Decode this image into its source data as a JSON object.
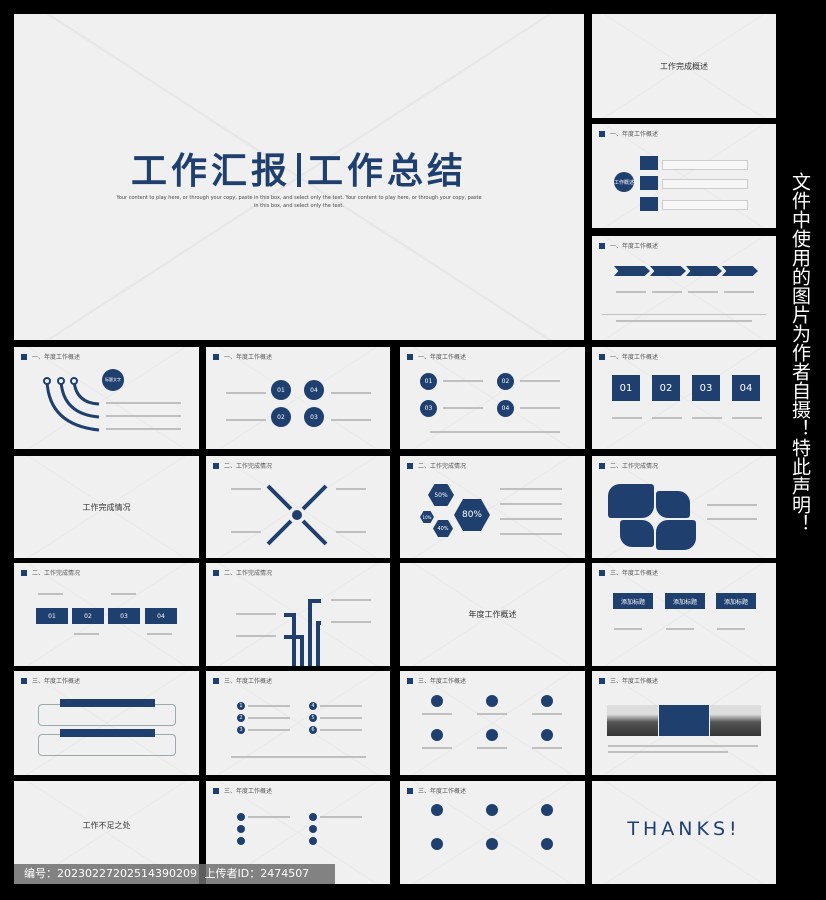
{
  "main_slide": {
    "title_left": "工作汇报",
    "title_right": "工作总结",
    "subtitle": "Your content to play here, or through your copy, paste in this box, and select only the text. Your content to play here, or through your copy, paste in this box, and select only the text."
  },
  "section_titles": {
    "overview1": "一、年度工作概述",
    "completion2": "二、工作完成情况",
    "overview3": "三、年度工作概述"
  },
  "slides": {
    "s_top_right": "工作完成概述",
    "s_flow_center": "工作概述",
    "s_curve_badge": "标题文字",
    "numbers": [
      "01",
      "02",
      "03",
      "04"
    ],
    "hex": [
      "50%",
      "80%",
      "10%",
      "40%"
    ],
    "chapter_completion": "工作完成情况",
    "chapter_overview": "年度工作概述",
    "box_title": "添加标题",
    "chapter_shortcoming": "工作不足之处",
    "thanks": "THANKS!",
    "list_numbers": [
      "1",
      "2",
      "3",
      "4",
      "5",
      "6"
    ]
  },
  "footer": {
    "id_label": "编号：20230227202514390209",
    "uploader_label": "上传者ID：2474507"
  },
  "side_notice": "文件中使用的图片为作者自摄！特此声明！",
  "colors": {
    "navy": "#1f3f6e",
    "slide_bg": "#f0f0f1",
    "background": "#000000"
  }
}
